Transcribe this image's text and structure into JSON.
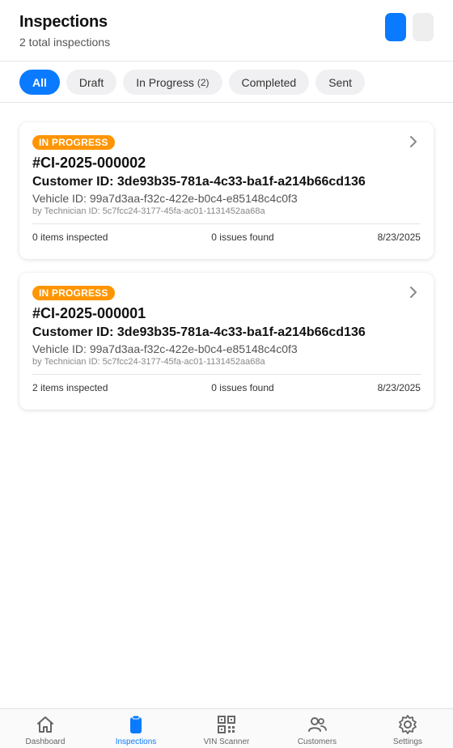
{
  "header": {
    "title": "Inspections",
    "subtitle": "2 total inspections"
  },
  "tabs": [
    {
      "label": "All",
      "active": true,
      "count": ""
    },
    {
      "label": "Draft",
      "active": false,
      "count": ""
    },
    {
      "label": "In Progress",
      "active": false,
      "count": "(2)"
    },
    {
      "label": "Completed",
      "active": false,
      "count": ""
    },
    {
      "label": "Sent",
      "active": false,
      "count": ""
    }
  ],
  "inspections": [
    {
      "status": "IN PROGRESS",
      "number": "#CI-2025-000002",
      "customer": "Customer ID: 3de93b35-781a-4c33-ba1f-a214b66cd136",
      "vehicle": "Vehicle ID: 99a7d3aa-f32c-422e-b0c4-e85148c4c0f3",
      "technician": "by Technician ID: 5c7fcc24-3177-45fa-ac01-1131452aa68a",
      "items": "0 items inspected",
      "issues": "0 issues found",
      "date": "8/23/2025"
    },
    {
      "status": "IN PROGRESS",
      "number": "#CI-2025-000001",
      "customer": "Customer ID: 3de93b35-781a-4c33-ba1f-a214b66cd136",
      "vehicle": "Vehicle ID: 99a7d3aa-f32c-422e-b0c4-e85148c4c0f3",
      "technician": "by Technician ID: 5c7fcc24-3177-45fa-ac01-1131452aa68a",
      "items": "2 items inspected",
      "issues": "0 issues found",
      "date": "8/23/2025"
    }
  ],
  "nav": {
    "items": [
      {
        "label": "Dashboard",
        "icon": "home-icon",
        "active": false
      },
      {
        "label": "Inspections",
        "icon": "clipboard-icon",
        "active": true
      },
      {
        "label": "VIN Scanner",
        "icon": "qr-code-icon",
        "active": false
      },
      {
        "label": "Customers",
        "icon": "people-icon",
        "active": false
      },
      {
        "label": "Settings",
        "icon": "gear-icon",
        "active": false
      }
    ]
  },
  "colors": {
    "accent": "#0a7aff",
    "status_in_progress": "#ff9500"
  }
}
